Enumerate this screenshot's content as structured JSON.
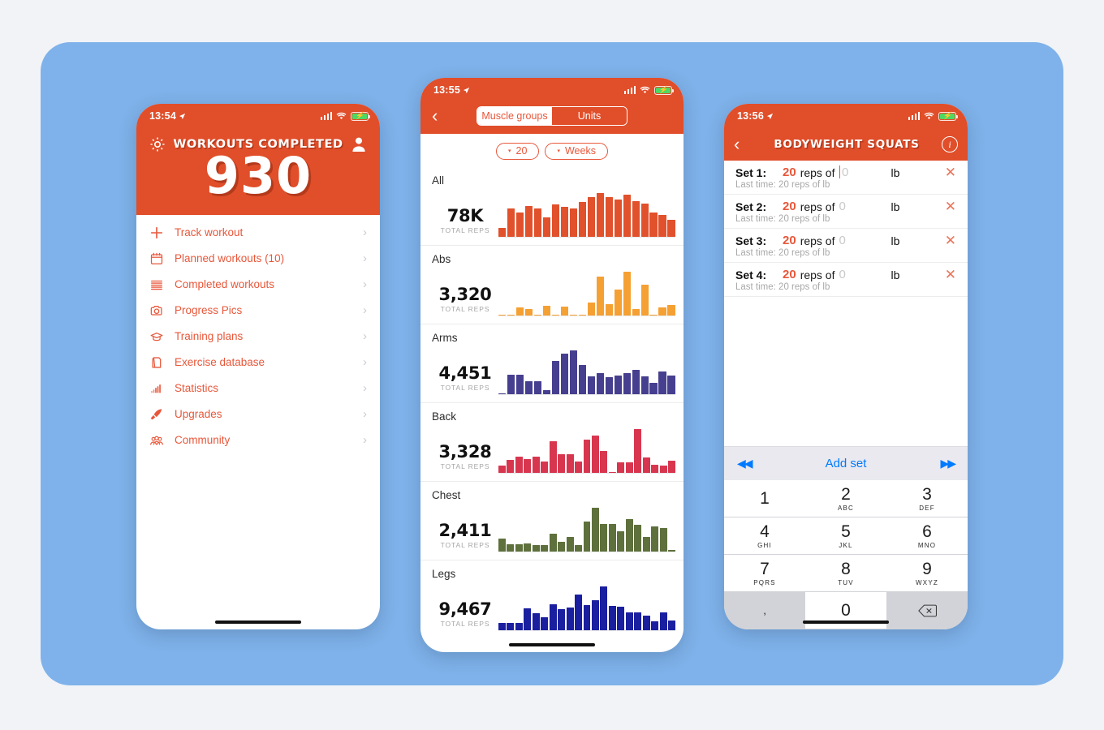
{
  "page": {
    "background": "#f1f3f7",
    "panel_color": "#7fb2ea",
    "brand_orange": "#e04e2a",
    "link_color": "#e8573a"
  },
  "phone1": {
    "status": {
      "time": "13:54",
      "location_arrow": "➤",
      "battery_charging": true
    },
    "header": {
      "title": "WORKOUTS COMPLETED",
      "count": "930",
      "settings_icon": "gear-icon",
      "profile_icon": "person-icon"
    },
    "menu": [
      {
        "label": "Track workout",
        "icon": "plus-icon"
      },
      {
        "label": "Planned workouts (10)",
        "icon": "calendar-icon"
      },
      {
        "label": "Completed workouts",
        "icon": "list-icon"
      },
      {
        "label": "Progress Pics",
        "icon": "camera-icon"
      },
      {
        "label": "Training plans",
        "icon": "graduation-cap-icon"
      },
      {
        "label": "Exercise database",
        "icon": "book-icon"
      },
      {
        "label": "Statistics",
        "icon": "bar-chart-icon"
      },
      {
        "label": "Upgrades",
        "icon": "rocket-icon"
      },
      {
        "label": "Community",
        "icon": "people-icon"
      }
    ],
    "chevron": "›"
  },
  "phone2": {
    "status": {
      "time": "13:55",
      "battery_charging": true
    },
    "nav": {
      "back": "‹",
      "segments": [
        {
          "label": "Muscle groups",
          "selected": true
        },
        {
          "label": "Units",
          "selected": false
        }
      ]
    },
    "filters": [
      {
        "label": "20",
        "caret": "▾"
      },
      {
        "label": "Weeks",
        "caret": "▾"
      }
    ],
    "total_reps_caption": "TOTAL REPS",
    "chart_data": [
      {
        "type": "bar",
        "title": "All",
        "total": "78K",
        "color": "#e0512c",
        "ylabel": "Total reps",
        "xlabel": "Weeks",
        "categories": [
          "1",
          "2",
          "3",
          "4",
          "5",
          "6",
          "7",
          "8",
          "9",
          "10",
          "11",
          "12",
          "13",
          "14",
          "15",
          "16",
          "17",
          "18",
          "19",
          "20"
        ],
        "values": [
          14,
          44,
          38,
          48,
          44,
          30,
          50,
          46,
          44,
          54,
          62,
          68,
          62,
          58,
          66,
          56,
          52,
          38,
          34,
          26
        ]
      },
      {
        "type": "bar",
        "title": "Abs",
        "total": "3,320",
        "color": "#f5a033",
        "ylabel": "Total reps",
        "xlabel": "Weeks",
        "categories": [
          "1",
          "2",
          "3",
          "4",
          "5",
          "6",
          "7",
          "8",
          "9",
          "10",
          "11",
          "12",
          "13",
          "14",
          "15",
          "16",
          "17",
          "18",
          "19",
          "20"
        ],
        "values": [
          1,
          1,
          10,
          8,
          1,
          12,
          1,
          11,
          1,
          1,
          16,
          48,
          14,
          32,
          54,
          8,
          38,
          1,
          10,
          13
        ]
      },
      {
        "type": "bar",
        "title": "Arms",
        "total": "4,451",
        "color": "#463f8f",
        "ylabel": "Total reps",
        "xlabel": "Weeks",
        "categories": [
          "1",
          "2",
          "3",
          "4",
          "5",
          "6",
          "7",
          "8",
          "9",
          "10",
          "11",
          "12",
          "13",
          "14",
          "15",
          "16",
          "17",
          "18",
          "19",
          "20"
        ],
        "values": [
          1,
          22,
          22,
          15,
          15,
          5,
          38,
          46,
          50,
          33,
          20,
          24,
          19,
          21,
          24,
          28,
          20,
          13,
          26,
          21
        ]
      },
      {
        "type": "bar",
        "title": "Back",
        "total": "3,328",
        "color": "#d8364f",
        "ylabel": "Total reps",
        "xlabel": "Weeks",
        "categories": [
          "1",
          "2",
          "3",
          "4",
          "5",
          "6",
          "7",
          "8",
          "9",
          "10",
          "11",
          "12",
          "13",
          "14",
          "15",
          "16",
          "17",
          "18",
          "19",
          "20"
        ],
        "values": [
          9,
          17,
          21,
          18,
          21,
          15,
          40,
          24,
          24,
          15,
          43,
          48,
          28,
          1,
          13,
          14,
          56,
          20,
          10,
          9,
          16
        ]
      },
      {
        "type": "bar",
        "title": "Chest",
        "total": "2,411",
        "color": "#5e703c",
        "ylabel": "Total reps",
        "xlabel": "Weeks",
        "categories": [
          "1",
          "2",
          "3",
          "4",
          "5",
          "6",
          "7",
          "8",
          "9",
          "10",
          "11",
          "12",
          "13",
          "14",
          "15",
          "16",
          "17",
          "18",
          "19",
          "20"
        ],
        "values": [
          14,
          8,
          8,
          9,
          7,
          7,
          20,
          11,
          16,
          7,
          33,
          48,
          30,
          30,
          22,
          36,
          29,
          16,
          28,
          26,
          2
        ]
      },
      {
        "type": "bar",
        "title": "Legs",
        "total": "9,467",
        "color": "#1a1fa0",
        "ylabel": "Total reps",
        "xlabel": "Weeks",
        "categories": [
          "1",
          "2",
          "3",
          "4",
          "5",
          "6",
          "7",
          "8",
          "9",
          "10",
          "11",
          "12",
          "13",
          "14",
          "15",
          "16",
          "17",
          "18",
          "19",
          "20"
        ],
        "values": [
          9,
          9,
          9,
          26,
          20,
          15,
          31,
          25,
          27,
          42,
          30,
          36,
          52,
          29,
          28,
          21,
          21,
          17,
          11,
          21,
          12
        ]
      }
    ]
  },
  "phone3": {
    "status": {
      "time": "13:56",
      "battery_charging": true
    },
    "nav": {
      "back": "‹",
      "title": "BODYWEIGHT SQUATS",
      "info_icon": "info-icon"
    },
    "unit": "lb",
    "reps_of_label": "reps of",
    "sets": [
      {
        "label": "Set 1:",
        "reps": "20",
        "weight": "0",
        "unit": "lb",
        "last": "Last time: 20 reps of lb",
        "focused": true
      },
      {
        "label": "Set 2:",
        "reps": "20",
        "weight": "0",
        "unit": "lb",
        "last": "Last time: 20 reps of lb",
        "focused": false
      },
      {
        "label": "Set 3:",
        "reps": "20",
        "weight": "0",
        "unit": "lb",
        "last": "Last time: 20 reps of lb",
        "focused": false
      },
      {
        "label": "Set 4:",
        "reps": "20",
        "weight": "0",
        "unit": "lb",
        "last": "Last time: 20 reps of lb",
        "focused": false
      }
    ],
    "remove_icon": "close-icon",
    "toolbar": {
      "prev": "◀◀",
      "add_set": "Add set",
      "next": "▶▶"
    },
    "keypad": [
      {
        "num": "1",
        "letters": ""
      },
      {
        "num": "2",
        "letters": "ABC"
      },
      {
        "num": "3",
        "letters": "DEF"
      },
      {
        "num": "4",
        "letters": "GHI"
      },
      {
        "num": "5",
        "letters": "JKL"
      },
      {
        "num": "6",
        "letters": "MNO"
      },
      {
        "num": "7",
        "letters": "PQRS"
      },
      {
        "num": "8",
        "letters": "TUV"
      },
      {
        "num": "9",
        "letters": "WXYZ"
      },
      {
        "num": ",",
        "letters": ""
      },
      {
        "num": "0",
        "letters": ""
      },
      {
        "num": "",
        "letters": "",
        "icon": "backspace-icon"
      }
    ]
  }
}
